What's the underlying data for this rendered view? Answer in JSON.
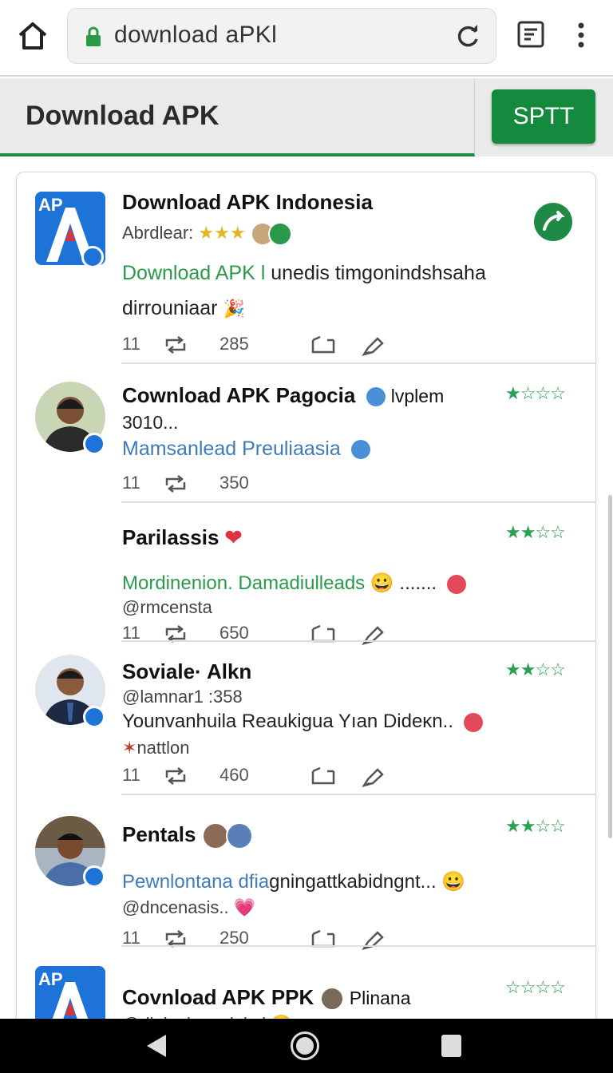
{
  "browser": {
    "url": "download aPKl",
    "icons": [
      "home-icon",
      "lock-icon",
      "reload-icon",
      "reader-mode-icon",
      "overflow-menu-icon"
    ]
  },
  "header": {
    "title": "Download APK",
    "action_label": "SPTT",
    "accent": "#1f8a46"
  },
  "feed": {
    "items": [
      {
        "title": "Download APK Indonesia",
        "subtitle": "Abrdlear:",
        "text_green": "Download APK l",
        "text": "unedis timgonindshsaha",
        "text2": "dirrouniaar",
        "replies": "11",
        "count": "285"
      },
      {
        "title": "Cownload APK Pagocia",
        "title_suffix": "lvplem",
        "subtitle": "3010...",
        "text_blue": "Mamsanlead Preuliaasia",
        "replies": "11",
        "count": "350",
        "rating": "★☆☆☆"
      },
      {
        "title": "Parilassis",
        "text_green": "Mordinenion. Damadiulleads",
        "text_tail": ".......",
        "handle": "@rmcensta",
        "replies": "11",
        "count": "650",
        "rating": "★★☆☆"
      },
      {
        "title": "Soviale· Alkn",
        "handle": "@lamnar1 :358",
        "text": "Younvanhuila Reaukigua Yıan Dideĸn..",
        "tag": "nattlon",
        "replies": "11",
        "count": "460",
        "rating": "★★☆☆"
      },
      {
        "title": "Pentals",
        "text_blue": "Pewnlontana dfia",
        "text": "gningattkabidngnt...",
        "handle": "@dncenasis..",
        "replies": "11",
        "count": "250",
        "rating": "★★☆☆"
      },
      {
        "title": "Covnload APK PPK",
        "title_suffix": "Plinana",
        "handle": "@dialaakemulnkal",
        "rating": "☆☆☆☆"
      }
    ]
  },
  "logo_text": "AP",
  "colors": {
    "brand_green": "#148a3f",
    "star_green": "#2aa050",
    "link_blue": "#3f7bb8",
    "logo_blue": "#1e73d8",
    "heart_red": "#e0323c"
  }
}
